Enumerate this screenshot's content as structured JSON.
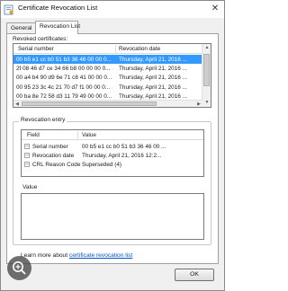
{
  "window": {
    "title": "Certificate Revocation List",
    "close_glyph": "✕"
  },
  "tabs": [
    {
      "label": "General",
      "active": false
    },
    {
      "label": "Revocation List",
      "active": true
    }
  ],
  "revoked": {
    "section_label": "Revoked certificates:",
    "columns": [
      "Serial number",
      "Revocation date"
    ],
    "rows": [
      {
        "serial": "00 b5 e1 cc b0 51 b3 36 46 00 00 0...",
        "date": "Thursday, April 21, 2016 ...",
        "selected": true
      },
      {
        "serial": "2f 08 46 d7 ce 34 66 b8 00 00 00 0...",
        "date": "Thursday, April 21, 2016 ...",
        "selected": false
      },
      {
        "serial": "00 a4 b4 90 d9 6e 71 c8 41 00 00 0...",
        "date": "Thursday, April 21, 2016 ...",
        "selected": false
      },
      {
        "serial": "00 95 23 3c 4c 21 70 d7 f1 00 00 0...",
        "date": "Thursday, April 21, 2016 ...",
        "selected": false
      },
      {
        "serial": "00 ba 8e 72 58 d3 11 79 49 00 00 0...",
        "date": "Thursday, April 21, 2016 ...",
        "selected": false
      }
    ]
  },
  "entry": {
    "group_title": "Revocation entry",
    "columns": [
      "Field",
      "Value"
    ],
    "rows": [
      {
        "field": "Serial number",
        "value": "00 b5 e1 cc b0 51 b3 36 46 00 ..."
      },
      {
        "field": "Revocation date",
        "value": "Thursday, April 21, 2016 12:2..."
      },
      {
        "field": "CRL Reason Code",
        "value": "Superseded (4)"
      }
    ],
    "value_label": "Value"
  },
  "footer": {
    "learn_more_prefix": "Learn more about ",
    "learn_more_link": "certificate revocation list",
    "ok_label": "OK"
  },
  "icons": {
    "title": "certificate-icon",
    "field": "field-document-icon",
    "zoom": "zoom-in-icon"
  },
  "colors": {
    "selection": "#3399ff",
    "link": "#0055cc"
  }
}
